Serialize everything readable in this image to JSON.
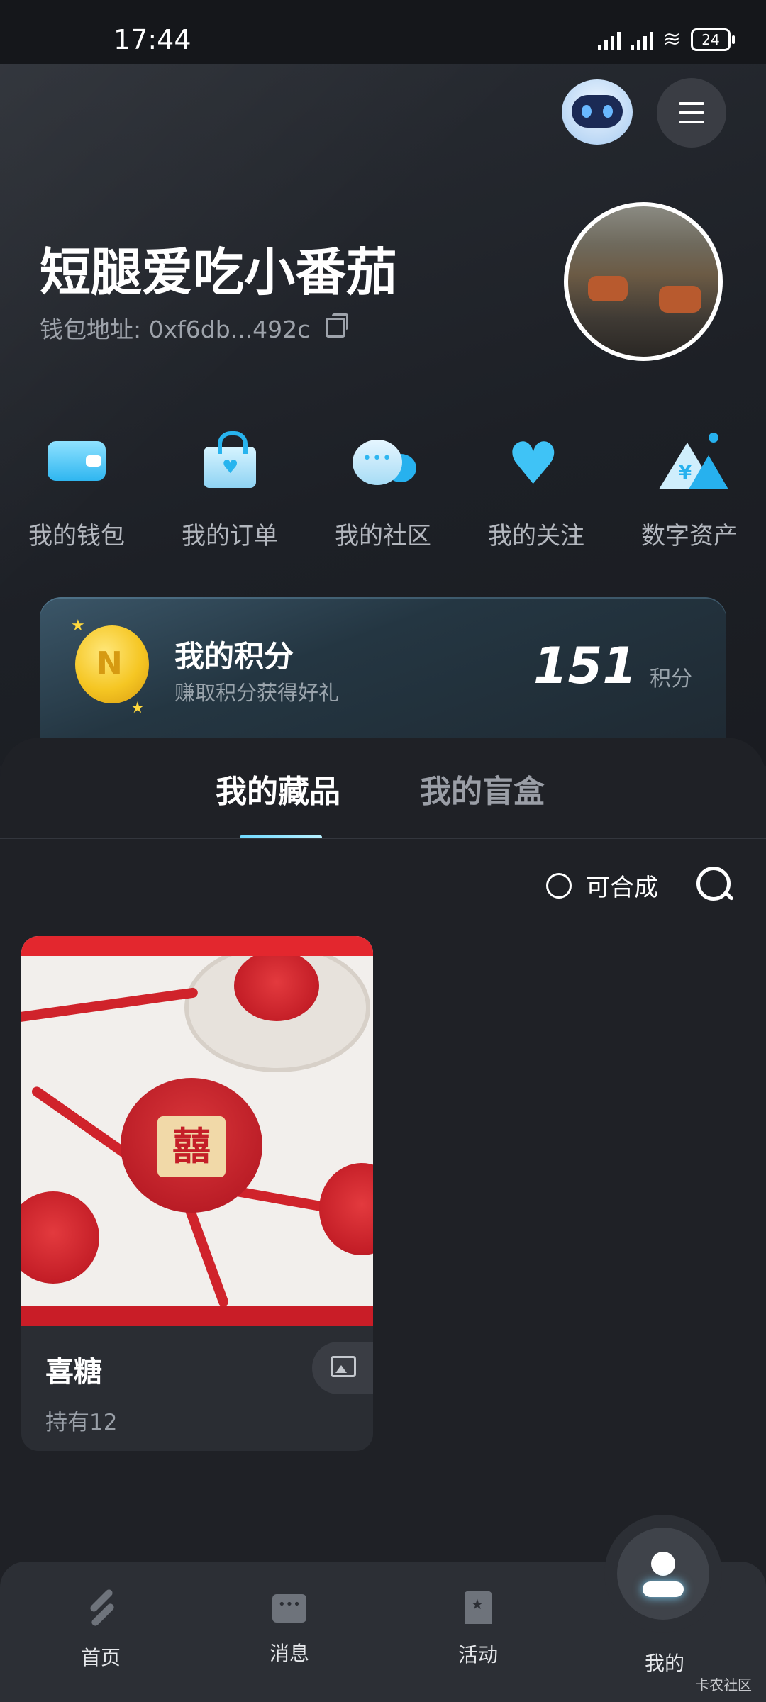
{
  "status_bar": {
    "time": "17:44",
    "battery": "24"
  },
  "profile": {
    "username": "短腿爱吃小番茄",
    "wallet_label": "钱包地址: 0xf6db...492c"
  },
  "shortcuts": [
    {
      "label": "我的钱包",
      "icon": "wallet-icon"
    },
    {
      "label": "我的订单",
      "icon": "shopping-bag-icon"
    },
    {
      "label": "我的社区",
      "icon": "chat-bubble-icon"
    },
    {
      "label": "我的关注",
      "icon": "heart-icon"
    },
    {
      "label": "数字资产",
      "icon": "digital-asset-icon"
    }
  ],
  "points": {
    "title": "我的积分",
    "subtitle": "赚取积分获得好礼",
    "value": "151",
    "unit": "积分",
    "coin_letter": "N"
  },
  "tabs": {
    "active": "我的藏品",
    "inactive": "我的盲盒"
  },
  "filter": {
    "label": "可合成"
  },
  "collection": [
    {
      "title": "喜糖",
      "holding": "持有12",
      "badge": "囍"
    }
  ],
  "bottom_nav": {
    "items": [
      {
        "label": "首页",
        "icon": "home-icon"
      },
      {
        "label": "消息",
        "icon": "message-icon"
      },
      {
        "label": "活动",
        "icon": "activity-icon"
      },
      {
        "label": "我的",
        "icon": "profile-icon"
      }
    ]
  },
  "watermark": "卡农社区",
  "colors": {
    "accent": "#2fb6f0",
    "background": "#1f2126",
    "card": "#2a2d33"
  }
}
